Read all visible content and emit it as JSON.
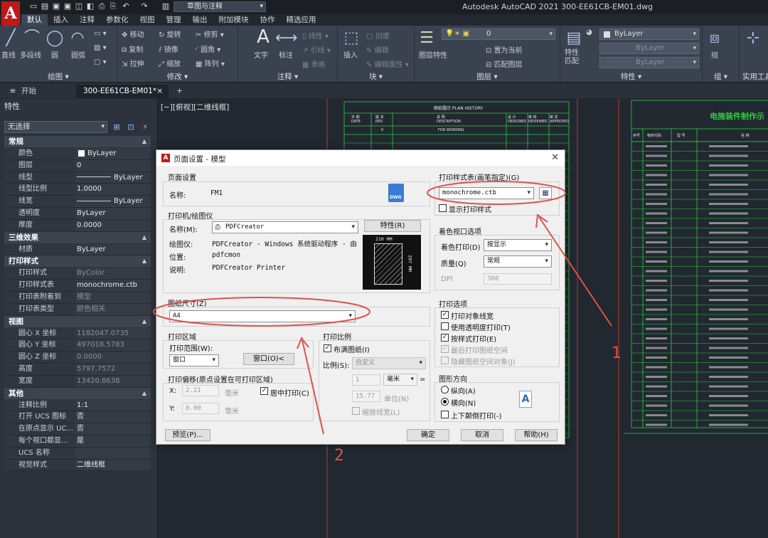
{
  "titlebar": {
    "app_logo": "A",
    "workspace": "草图与注释",
    "title": "Autodesk AutoCAD 2021    300-EE61CB-EM01.dwg"
  },
  "ribbon_tabs": [
    "默认",
    "插入",
    "注释",
    "参数化",
    "视图",
    "管理",
    "输出",
    "附加模块",
    "协作",
    "精选应用"
  ],
  "ribbon": {
    "draw": {
      "label": "绘图",
      "line": "直线",
      "polyline": "多段线",
      "circle": "圆",
      "arc": "圆弧"
    },
    "modify": {
      "label": "修改",
      "move": "移动",
      "rotate": "旋转",
      "trim": "修剪",
      "copy": "复制",
      "mirror": "镜像",
      "fillet": "圆角",
      "stretch": "拉伸",
      "scale": "缩放",
      "array": "阵列"
    },
    "annotation": {
      "label": "注释",
      "text": "文字",
      "dimension": "标注",
      "linear": "线性",
      "leader": "引线",
      "table": "表格"
    },
    "block": {
      "label": "块",
      "insert": "插入",
      "create": "创建",
      "edit": "编辑",
      "edit_attr": "编辑属性"
    },
    "layers": {
      "label": "图层",
      "layer_props": "图层特性",
      "layer_value": "0",
      "make_current": "置为当前",
      "match_layer": "匹配图层"
    },
    "properties": {
      "label": "特性",
      "match": "特性匹配",
      "color": "ByLayer",
      "linetype": "ByLayer",
      "lineweight": "ByLayer"
    },
    "groups": {
      "label": "组",
      "group": "组"
    },
    "utilities": {
      "label": "实用工具"
    }
  },
  "doc_tabs": {
    "start": "开始",
    "drawing": "300-EE61CB-EM01*",
    "close": "×",
    "add": "+"
  },
  "props": {
    "title": "特性",
    "selection": "无选择",
    "sections": [
      {
        "name": "常规",
        "rows": [
          {
            "k": "颜色",
            "v": "ByLayer"
          },
          {
            "k": "图层",
            "v": "0"
          },
          {
            "k": "线型",
            "v": "ByLayer"
          },
          {
            "k": "线型比例",
            "v": "1.0000"
          },
          {
            "k": "线宽",
            "v": "ByLayer"
          },
          {
            "k": "透明度",
            "v": "ByLayer"
          },
          {
            "k": "厚度",
            "v": "0.0000"
          }
        ]
      },
      {
        "name": "三维效果",
        "rows": [
          {
            "k": "材质",
            "v": "ByLayer"
          }
        ]
      },
      {
        "name": "打印样式",
        "rows": [
          {
            "k": "打印样式",
            "v": "ByColor"
          },
          {
            "k": "打印样式表",
            "v": "monochrome.ctb"
          },
          {
            "k": "打印表附着到",
            "v": "模型"
          },
          {
            "k": "打印表类型",
            "v": "颜色相关"
          }
        ]
      },
      {
        "name": "视图",
        "rows": [
          {
            "k": "圆心 X 坐标",
            "v": "1182047.0735"
          },
          {
            "k": "圆心 Y 坐标",
            "v": "497018.5783"
          },
          {
            "k": "圆心 Z 坐标",
            "v": "0.0000"
          },
          {
            "k": "高度",
            "v": "5797.7572"
          },
          {
            "k": "宽度",
            "v": "13420.8638"
          }
        ]
      },
      {
        "name": "其他",
        "rows": [
          {
            "k": "注释比例",
            "v": "1:1"
          },
          {
            "k": "打开 UCS 图标",
            "v": "否"
          },
          {
            "k": "在原点显示 UC...",
            "v": "否"
          },
          {
            "k": "每个视口都显...",
            "v": "是"
          },
          {
            "k": "UCS 名称",
            "v": ""
          },
          {
            "k": "视觉样式",
            "v": "二维线框"
          }
        ]
      }
    ]
  },
  "canvas": {
    "view_label": "[−][俯视][二维线框]",
    "plan_history": {
      "title": "图纸履历 PLAN HISTORY",
      "headers": [
        "日 期\nDATE",
        "版 本\nREV.",
        "说 明\nDESCRIPTION",
        "设 计\nDESIGNED",
        "审 核\nREVIEWED",
        "审 定\nAPPROVED"
      ],
      "row1": [
        "",
        "0",
        "FOR WORKING",
        "",
        "",
        ""
      ]
    },
    "table_title": "电施装件制作示",
    "table_headers": [
      "序号",
      "物资代码",
      "型 号",
      "名 称"
    ]
  },
  "dialog": {
    "title": "页面设置 - 模型",
    "page_setup": {
      "group": "页面设置",
      "name_label": "名称:",
      "name_value": "FM1",
      "dwg_icon": "DWG"
    },
    "plotter": {
      "group": "打印机/绘图仪",
      "name_label": "名称(M):",
      "name_value": "PDFCreator",
      "properties_button": "特性(R)",
      "plotter_label": "绘图仪:",
      "plotter_value": "PDFCreator - Windows 系统驱动程序 - 由 A...",
      "location_label": "位置:",
      "location_value": "pdfcmon",
      "desc_label": "说明:",
      "desc_value": "PDFCreator Printer",
      "preview_width": "210 MM",
      "preview_height": "297 MM"
    },
    "paper_size": {
      "group": "图纸尺寸(Z)",
      "value": "A4"
    },
    "plot_area": {
      "group": "打印区域",
      "range_label": "打印范围(W):",
      "range_value": "窗口",
      "window_button": "窗口(O)<"
    },
    "plot_offset": {
      "group": "打印偏移(原点设置在可打印区域)",
      "x_label": "X:",
      "x_value": "2.21",
      "x_unit": "毫米",
      "y_label": "Y:",
      "y_value": "0.00",
      "y_unit": "毫米",
      "center_label": "居中打印(C)"
    },
    "plot_scale": {
      "group": "打印比例",
      "fit_label": "布满图纸(I)",
      "scale_label": "比例(S):",
      "scale_value": "自定义",
      "value1": "1",
      "unit1": "毫米",
      "value2": "15.77",
      "unit2": "单位(N)",
      "lineweights_label": "缩放线宽(L)"
    },
    "style_table": {
      "group": "打印样式表(画笔指定)(G)",
      "value": "monochrome.ctb",
      "show_label": "显示打印样式"
    },
    "shaded_viewport": {
      "group": "着色视口选项",
      "shade_label": "着色打印(D)",
      "shade_value": "按显示",
      "quality_label": "质量(Q)",
      "quality_value": "常规",
      "dpi_label": "DPI",
      "dpi_value": "300"
    },
    "plot_options": {
      "group": "打印选项",
      "opt1": "打印对象线宽",
      "opt2": "使用透明度打印(T)",
      "opt3": "按样式打印(E)",
      "opt4": "最后打印图纸空间",
      "opt5": "隐藏图纸空间对象(J)"
    },
    "orientation": {
      "group": "图形方向",
      "portrait": "纵向(A)",
      "landscape": "横向(N)",
      "upside": "上下颠倒打印(-)"
    },
    "buttons": {
      "preview": "预览(P)...",
      "ok": "确定",
      "cancel": "取消",
      "help": "帮助(H)"
    }
  },
  "annotations": {
    "one": "1",
    "two": "2"
  }
}
